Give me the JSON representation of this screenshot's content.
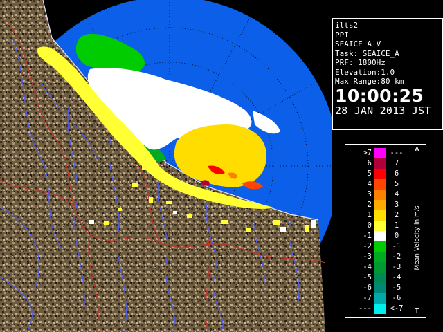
{
  "info": {
    "site": "ilts2",
    "scan_type": "PPI",
    "product": "SEAICE_A_V",
    "task": "Task: SEAICE_A",
    "prf": "PRF: 1800Hz",
    "elevation": "Elevation:1.0",
    "max_range": "Max Range:80 km",
    "time": "10:00:25",
    "date": "28 JAN 2013 JST"
  },
  "legend": {
    "title": "Mean Velocity in m/s",
    "top_letter": "A",
    "bottom_letter": "T",
    "rows": [
      {
        "left": ">7",
        "right": "---",
        "color": "#ff00ff"
      },
      {
        "left": "6",
        "right": "7",
        "color": "#b00038"
      },
      {
        "left": "5",
        "right": "6",
        "color": "#ff0000"
      },
      {
        "left": "4",
        "right": "5",
        "color": "#ff4500"
      },
      {
        "left": "3",
        "right": "4",
        "color": "#ff7f00"
      },
      {
        "left": "2",
        "right": "3",
        "color": "#ffaa00"
      },
      {
        "left": "1",
        "right": "2",
        "color": "#ffdd00"
      },
      {
        "left": "0",
        "right": "1",
        "color": "#ffff33"
      },
      {
        "left": "-1",
        "right": "0",
        "color": "#ffffff"
      },
      {
        "left": "-2",
        "right": "-1",
        "color": "#00cc00"
      },
      {
        "left": "-3",
        "right": "-2",
        "color": "#00aa22"
      },
      {
        "left": "-4",
        "right": "-3",
        "color": "#009933"
      },
      {
        "left": "-5",
        "right": "-4",
        "color": "#008855"
      },
      {
        "left": "-6",
        "right": "-5",
        "color": "#008877"
      },
      {
        "left": "-7",
        "right": "-6",
        "color": "#00aaaa"
      },
      {
        "left": "---",
        "right": "<-7",
        "color": "#00eeee"
      }
    ]
  },
  "colors": {
    "sea": "#0b5fe8",
    "land": "#6b5a3f",
    "river": "#4a5cff",
    "boundary": "#cc3030"
  }
}
